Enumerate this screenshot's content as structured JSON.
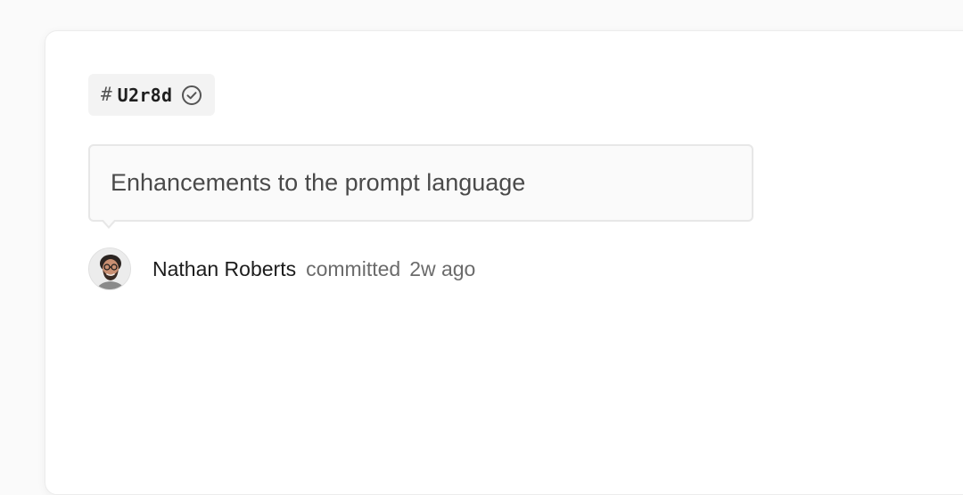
{
  "commit": {
    "hash_symbol": "#",
    "id": "U2r8d",
    "status_icon": "check-circle-icon",
    "message": "Enhancements to the prompt language"
  },
  "author": {
    "name": "Nathan Roberts",
    "action": "committed",
    "time": "2w ago",
    "avatar_icon": "avatar"
  },
  "colors": {
    "card_bg": "#ffffff",
    "badge_bg": "#f3f3f3",
    "message_bg": "#fafafa",
    "message_border": "#e7e7e7",
    "primary_text": "#1c1c1c",
    "secondary_text": "#6b6b6b"
  }
}
